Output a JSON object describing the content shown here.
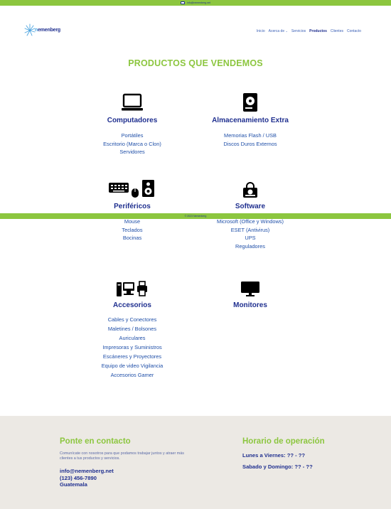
{
  "topbar": {
    "email": "info@nemenberg.net",
    "mail_icon": "mail-icon",
    "color": "#8cc63f"
  },
  "header": {
    "logo_icon": "starburst-logo-icon",
    "logo_prefix": "n",
    "logo_rest": "emenberg",
    "nav": [
      {
        "label": "Inicio"
      },
      {
        "label": "Acerca de",
        "has_dropdown": true
      },
      {
        "label": "Servicios"
      },
      {
        "label": "Productos",
        "active": true
      },
      {
        "label": "Clientes"
      },
      {
        "label": "Contacto"
      }
    ]
  },
  "main": {
    "title": "PRODUCTOS QUE VENDEMOS",
    "categories": {
      "computadores": {
        "icon": "laptop-icon",
        "title": "Computadores",
        "items": [
          "Portátiles",
          "Escritorio (Marca o Clon)",
          "Servidores"
        ]
      },
      "almacenamiento": {
        "icon": "hard-drive-icon",
        "title": "Almacenamiento Extra",
        "items": [
          "Memorias Flash / USB",
          "Discos Duros Externos"
        ]
      },
      "perifericos": {
        "icon": "keyboard-mouse-speaker-icon",
        "title": "Periféricos",
        "items": [
          "Mouse",
          "Teclados",
          "Bocinas"
        ]
      },
      "software": {
        "icon": "lock-disk-icon",
        "title": "Software",
        "items": [
          "Microsoft (Office y Windows)",
          "ESET (Antivirus)",
          "UPS",
          "Reguladores"
        ]
      },
      "accesorios": {
        "icon": "desktop-printer-icon",
        "title": "Accesorios",
        "items": [
          "Cables y Conectores",
          "Maletines / Bolsones",
          "Auriculares",
          "Impresoras y Suministros",
          "Escáneres y Proyectores",
          "Equipo de video Vigilancia",
          "Accesorios Gamer"
        ]
      },
      "monitores": {
        "icon": "monitor-icon",
        "title": "Monitores",
        "items": []
      }
    }
  },
  "band": {
    "text": "© 2023 Nemenberg",
    "color": "#8cc63f"
  },
  "footer": {
    "contact": {
      "title": "Ponte en contacto",
      "description": "Comunícate con nosotros para que podamos trabajar juntos y atraer más clientes a tus productos y servicios.",
      "email": "info@nemenberg.net",
      "phone": "(123) 456-7890",
      "location": "Guatemala"
    },
    "hours": {
      "title": "Horario de operación",
      "weekdays": "Lunes a Viernes: ?? - ??",
      "weekend": "Sabado y Domingo: ?? - ??"
    }
  },
  "colors": {
    "accent_green": "#8cc63f",
    "brand_blue": "#1f2f8f",
    "footer_bg": "#ece9e4"
  }
}
